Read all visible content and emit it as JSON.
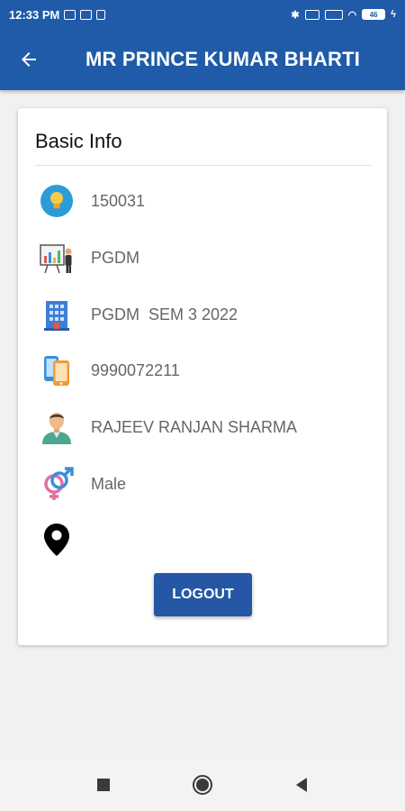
{
  "status_bar": {
    "time": "12:33 PM",
    "battery": "46"
  },
  "app_bar": {
    "title": "MR PRINCE KUMAR BHARTI"
  },
  "card": {
    "heading": "Basic Info",
    "rows": [
      {
        "icon": "bulb-icon",
        "value": "150031"
      },
      {
        "icon": "presentation-icon",
        "value": "PGDM"
      },
      {
        "icon": "building-icon",
        "value": "PGDM  SEM 3 2022"
      },
      {
        "icon": "phones-icon",
        "value": "9990072211"
      },
      {
        "icon": "person-icon",
        "value": "RAJEEV RANJAN SHARMA"
      },
      {
        "icon": "gender-icon",
        "value": "Male"
      },
      {
        "icon": "location-pin-icon",
        "value": ""
      }
    ],
    "logout_label": "LOGOUT"
  },
  "colors": {
    "primary": "#1f5ba8",
    "button": "#2557a5"
  }
}
